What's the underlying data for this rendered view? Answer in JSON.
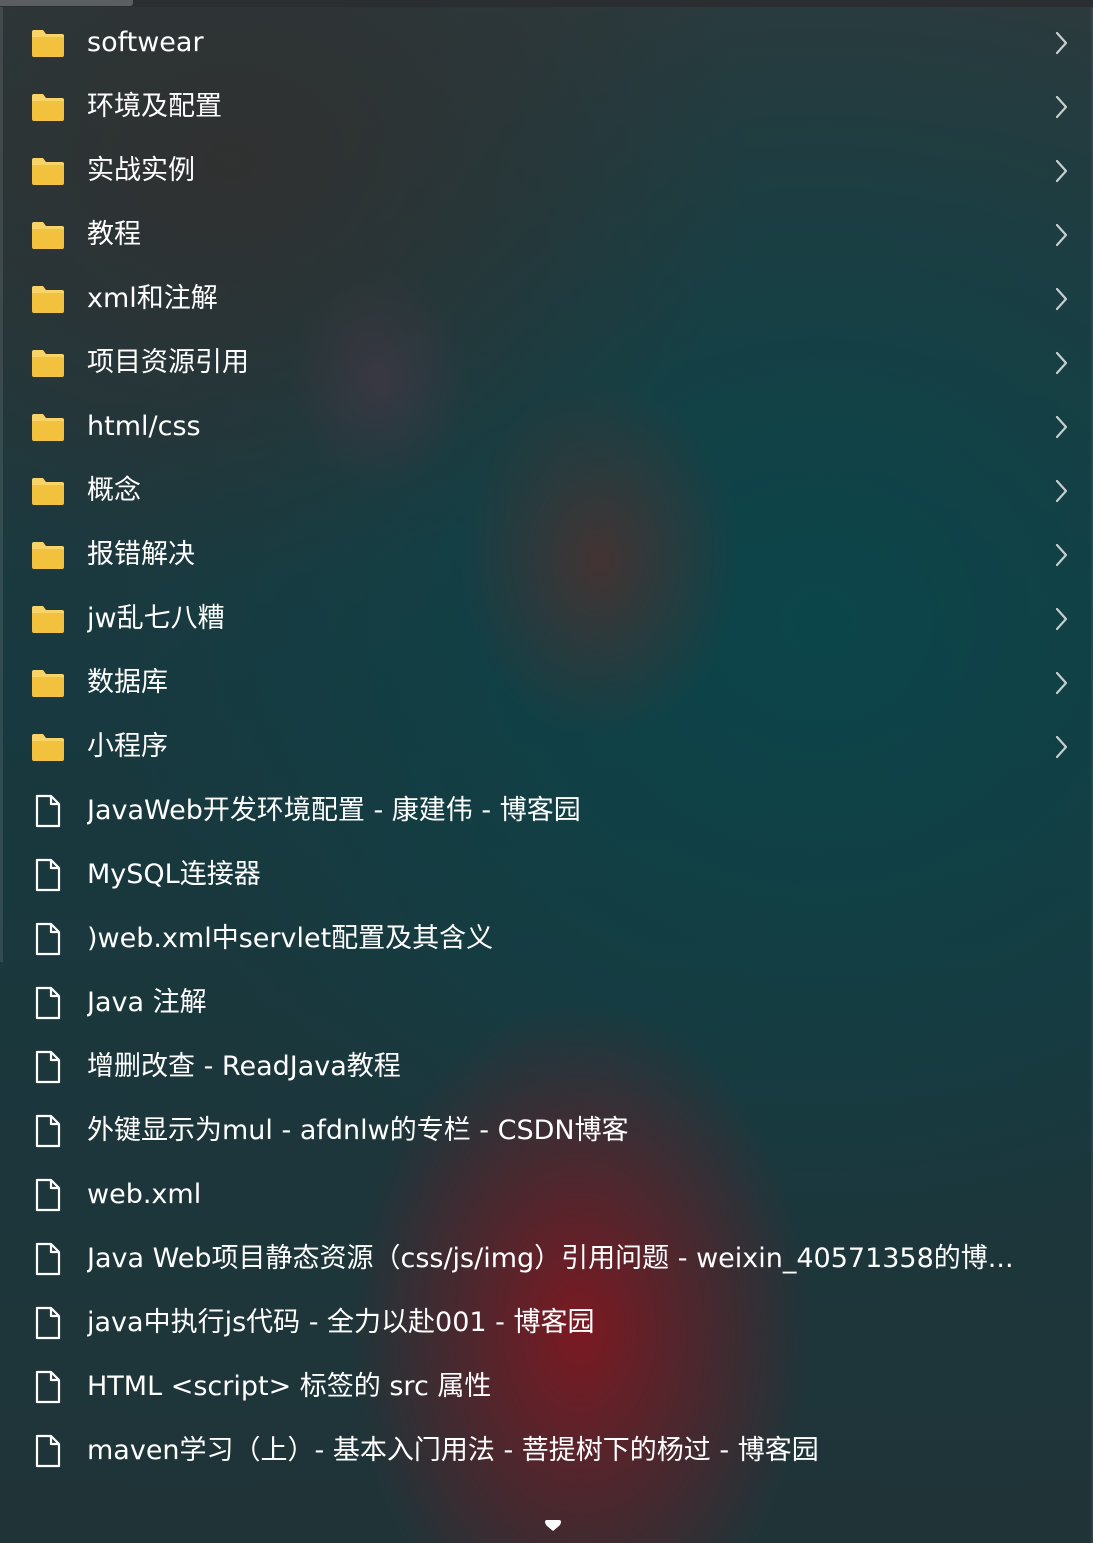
{
  "menu": {
    "folders": [
      {
        "label": "softwear",
        "icon": "folder-icon",
        "submenu": true
      },
      {
        "label": "环境及配置",
        "icon": "folder-icon",
        "submenu": true
      },
      {
        "label": "实战实例",
        "icon": "folder-icon",
        "submenu": true
      },
      {
        "label": "教程",
        "icon": "folder-icon",
        "submenu": true
      },
      {
        "label": "xml和注解",
        "icon": "folder-icon",
        "submenu": true
      },
      {
        "label": "项目资源引用",
        "icon": "folder-icon",
        "submenu": true
      },
      {
        "label": "html/css",
        "icon": "folder-icon",
        "submenu": true
      },
      {
        "label": "概念",
        "icon": "folder-icon",
        "submenu": true
      },
      {
        "label": "报错解决",
        "icon": "folder-icon",
        "submenu": true
      },
      {
        "label": "jw乱七八糟",
        "icon": "folder-icon",
        "submenu": true
      },
      {
        "label": "数据库",
        "icon": "folder-icon",
        "submenu": true
      },
      {
        "label": "小程序",
        "icon": "folder-icon",
        "submenu": true
      }
    ],
    "bookmarks": [
      {
        "label": "JavaWeb开发环境配置 - 康建伟 - 博客园",
        "icon": "page-icon"
      },
      {
        "label": "MySQL连接器",
        "icon": "page-icon"
      },
      {
        "label": ")web.xml中servlet配置及其含义",
        "icon": "page-icon"
      },
      {
        "label": "Java 注解",
        "icon": "page-icon"
      },
      {
        "label": "增删改查 - ReadJava教程",
        "icon": "page-icon"
      },
      {
        "label": "外键显示为mul - afdnlw的专栏 - CSDN博客",
        "icon": "page-icon"
      },
      {
        "label": "web.xml",
        "icon": "page-icon"
      },
      {
        "label": "Java Web项目静态资源（css/js/img）引用问题 - weixin_40571358的博...",
        "icon": "page-icon"
      },
      {
        "label": "java中执行js代码 - 全力以赴001 - 博客园",
        "icon": "page-icon"
      },
      {
        "label": "HTML <script> 标签的 src 属性",
        "icon": "page-icon"
      },
      {
        "label": "maven学习（上）- 基本入门用法 - 菩提树下的杨过 - 博客园",
        "icon": "page-icon"
      }
    ]
  },
  "colors": {
    "folder_body": "#f2c13d",
    "folder_tab": "#f7d368",
    "text": "#ffffff",
    "chevron": "#c8cdcf"
  },
  "scroll_indicator": {
    "icon": "scroll-down-icon"
  }
}
